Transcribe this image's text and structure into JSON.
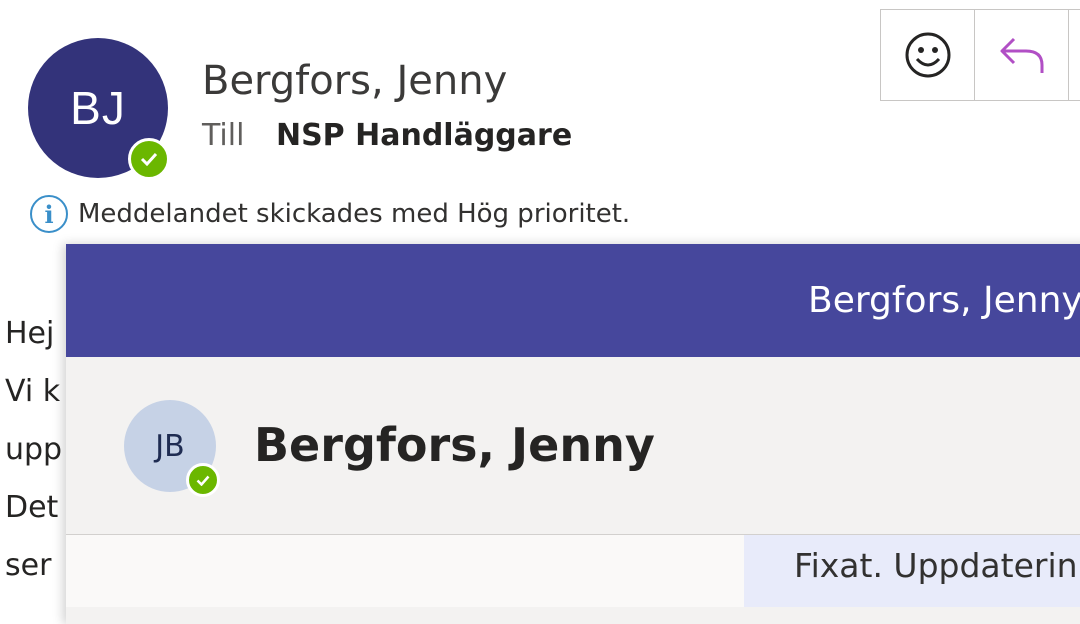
{
  "sender": {
    "initials": "BJ",
    "name": "Bergfors, Jenny",
    "status": "available"
  },
  "recipient": {
    "label": "Till",
    "value": "NSP Handläggare"
  },
  "priority_notice": "Meddelandet skickades med Hög prioritet.",
  "toolbar": {
    "icons": [
      "emoji-icon",
      "reply-icon"
    ]
  },
  "body_lines": [
    "Hej",
    "Vi k",
    "upp",
    "Det",
    "ser"
  ],
  "contact_card": {
    "header_name": "Bergfors, Jenny",
    "initials": "JB",
    "name": "Bergfors, Jenny",
    "message_preview": "Fixat. Uppdaterin"
  },
  "colors": {
    "avatar": "#33337a",
    "header": "#46479c",
    "presence": "#6bb700",
    "info": "#3a8fc9",
    "reply_accent": "#b14fc5"
  }
}
